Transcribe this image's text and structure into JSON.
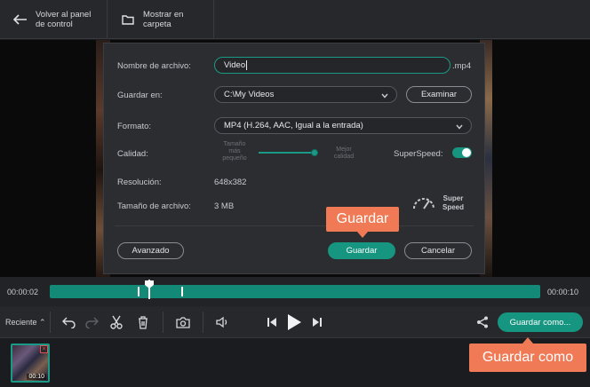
{
  "topbar": {
    "back_label": "Volver al panel\nde control",
    "folder_label": "Mostrar en\ncarpeta"
  },
  "dialog": {
    "filename_label": "Nombre de archivo:",
    "filename_value": "Video",
    "extension": ".mp4",
    "save_in_label": "Guardar en:",
    "save_in_value": "C:\\My Videos",
    "browse_label": "Examinar",
    "format_label": "Formato:",
    "format_value": "MP4 (H.264, AAC, Igual a la entrada)",
    "quality_label": "Calidad:",
    "quality_low_note": "Tamaño\nmás\npequeño",
    "quality_high_note": "Mejor\ncalidad",
    "quality_level": 1.0,
    "superspeed_label": "SuperSpeed:",
    "superspeed_on": true,
    "resolution_label": "Resolución:",
    "resolution_value": "648x382",
    "filesize_label": "Tamaño de archivo:",
    "filesize_value": "3 MB",
    "superspeed_badge": "Super\nSpeed",
    "advanced_label": "Avanzado",
    "save_label": "Guardar",
    "cancel_label": "Cancelar"
  },
  "callouts": {
    "save_callout": "Guardar",
    "save_as_callout": "Guardar como"
  },
  "timeline": {
    "start_time": "00:00:02",
    "end_time": "00:00:10"
  },
  "controls": {
    "recent_label": "Reciente",
    "save_as_label": "Guardar como..."
  },
  "clips": [
    {
      "duration": "00:10"
    }
  ],
  "colors": {
    "accent": "#169580",
    "callout": "#f07a55",
    "background": "#1b1c1f",
    "panel": "#2c2d31"
  }
}
